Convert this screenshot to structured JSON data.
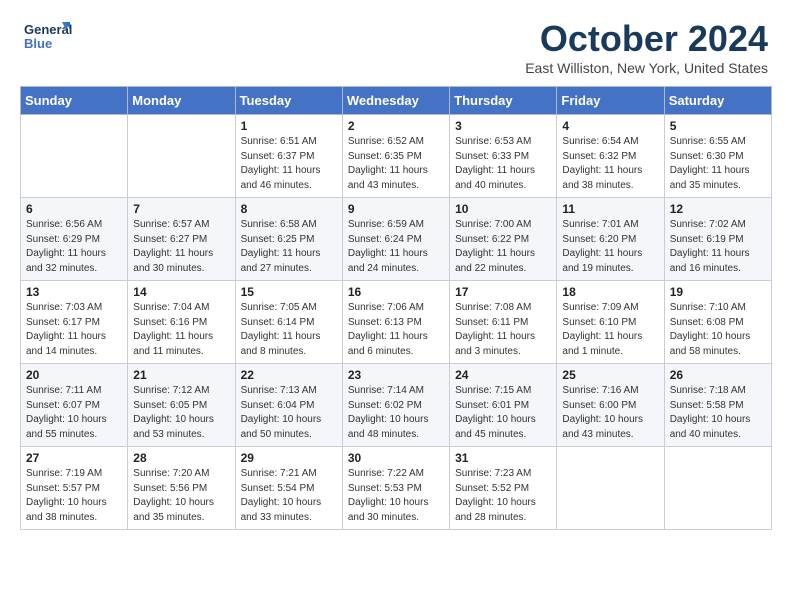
{
  "header": {
    "logo_line1": "General",
    "logo_line2": "Blue",
    "title": "October 2024",
    "subtitle": "East Williston, New York, United States"
  },
  "weekdays": [
    "Sunday",
    "Monday",
    "Tuesday",
    "Wednesday",
    "Thursday",
    "Friday",
    "Saturday"
  ],
  "weeks": [
    [
      {
        "day": "",
        "content": ""
      },
      {
        "day": "",
        "content": ""
      },
      {
        "day": "1",
        "content": "Sunrise: 6:51 AM\nSunset: 6:37 PM\nDaylight: 11 hours and 46 minutes."
      },
      {
        "day": "2",
        "content": "Sunrise: 6:52 AM\nSunset: 6:35 PM\nDaylight: 11 hours and 43 minutes."
      },
      {
        "day": "3",
        "content": "Sunrise: 6:53 AM\nSunset: 6:33 PM\nDaylight: 11 hours and 40 minutes."
      },
      {
        "day": "4",
        "content": "Sunrise: 6:54 AM\nSunset: 6:32 PM\nDaylight: 11 hours and 38 minutes."
      },
      {
        "day": "5",
        "content": "Sunrise: 6:55 AM\nSunset: 6:30 PM\nDaylight: 11 hours and 35 minutes."
      }
    ],
    [
      {
        "day": "6",
        "content": "Sunrise: 6:56 AM\nSunset: 6:29 PM\nDaylight: 11 hours and 32 minutes."
      },
      {
        "day": "7",
        "content": "Sunrise: 6:57 AM\nSunset: 6:27 PM\nDaylight: 11 hours and 30 minutes."
      },
      {
        "day": "8",
        "content": "Sunrise: 6:58 AM\nSunset: 6:25 PM\nDaylight: 11 hours and 27 minutes."
      },
      {
        "day": "9",
        "content": "Sunrise: 6:59 AM\nSunset: 6:24 PM\nDaylight: 11 hours and 24 minutes."
      },
      {
        "day": "10",
        "content": "Sunrise: 7:00 AM\nSunset: 6:22 PM\nDaylight: 11 hours and 22 minutes."
      },
      {
        "day": "11",
        "content": "Sunrise: 7:01 AM\nSunset: 6:20 PM\nDaylight: 11 hours and 19 minutes."
      },
      {
        "day": "12",
        "content": "Sunrise: 7:02 AM\nSunset: 6:19 PM\nDaylight: 11 hours and 16 minutes."
      }
    ],
    [
      {
        "day": "13",
        "content": "Sunrise: 7:03 AM\nSunset: 6:17 PM\nDaylight: 11 hours and 14 minutes."
      },
      {
        "day": "14",
        "content": "Sunrise: 7:04 AM\nSunset: 6:16 PM\nDaylight: 11 hours and 11 minutes."
      },
      {
        "day": "15",
        "content": "Sunrise: 7:05 AM\nSunset: 6:14 PM\nDaylight: 11 hours and 8 minutes."
      },
      {
        "day": "16",
        "content": "Sunrise: 7:06 AM\nSunset: 6:13 PM\nDaylight: 11 hours and 6 minutes."
      },
      {
        "day": "17",
        "content": "Sunrise: 7:08 AM\nSunset: 6:11 PM\nDaylight: 11 hours and 3 minutes."
      },
      {
        "day": "18",
        "content": "Sunrise: 7:09 AM\nSunset: 6:10 PM\nDaylight: 11 hours and 1 minute."
      },
      {
        "day": "19",
        "content": "Sunrise: 7:10 AM\nSunset: 6:08 PM\nDaylight: 10 hours and 58 minutes."
      }
    ],
    [
      {
        "day": "20",
        "content": "Sunrise: 7:11 AM\nSunset: 6:07 PM\nDaylight: 10 hours and 55 minutes."
      },
      {
        "day": "21",
        "content": "Sunrise: 7:12 AM\nSunset: 6:05 PM\nDaylight: 10 hours and 53 minutes."
      },
      {
        "day": "22",
        "content": "Sunrise: 7:13 AM\nSunset: 6:04 PM\nDaylight: 10 hours and 50 minutes."
      },
      {
        "day": "23",
        "content": "Sunrise: 7:14 AM\nSunset: 6:02 PM\nDaylight: 10 hours and 48 minutes."
      },
      {
        "day": "24",
        "content": "Sunrise: 7:15 AM\nSunset: 6:01 PM\nDaylight: 10 hours and 45 minutes."
      },
      {
        "day": "25",
        "content": "Sunrise: 7:16 AM\nSunset: 6:00 PM\nDaylight: 10 hours and 43 minutes."
      },
      {
        "day": "26",
        "content": "Sunrise: 7:18 AM\nSunset: 5:58 PM\nDaylight: 10 hours and 40 minutes."
      }
    ],
    [
      {
        "day": "27",
        "content": "Sunrise: 7:19 AM\nSunset: 5:57 PM\nDaylight: 10 hours and 38 minutes."
      },
      {
        "day": "28",
        "content": "Sunrise: 7:20 AM\nSunset: 5:56 PM\nDaylight: 10 hours and 35 minutes."
      },
      {
        "day": "29",
        "content": "Sunrise: 7:21 AM\nSunset: 5:54 PM\nDaylight: 10 hours and 33 minutes."
      },
      {
        "day": "30",
        "content": "Sunrise: 7:22 AM\nSunset: 5:53 PM\nDaylight: 10 hours and 30 minutes."
      },
      {
        "day": "31",
        "content": "Sunrise: 7:23 AM\nSunset: 5:52 PM\nDaylight: 10 hours and 28 minutes."
      },
      {
        "day": "",
        "content": ""
      },
      {
        "day": "",
        "content": ""
      }
    ]
  ]
}
